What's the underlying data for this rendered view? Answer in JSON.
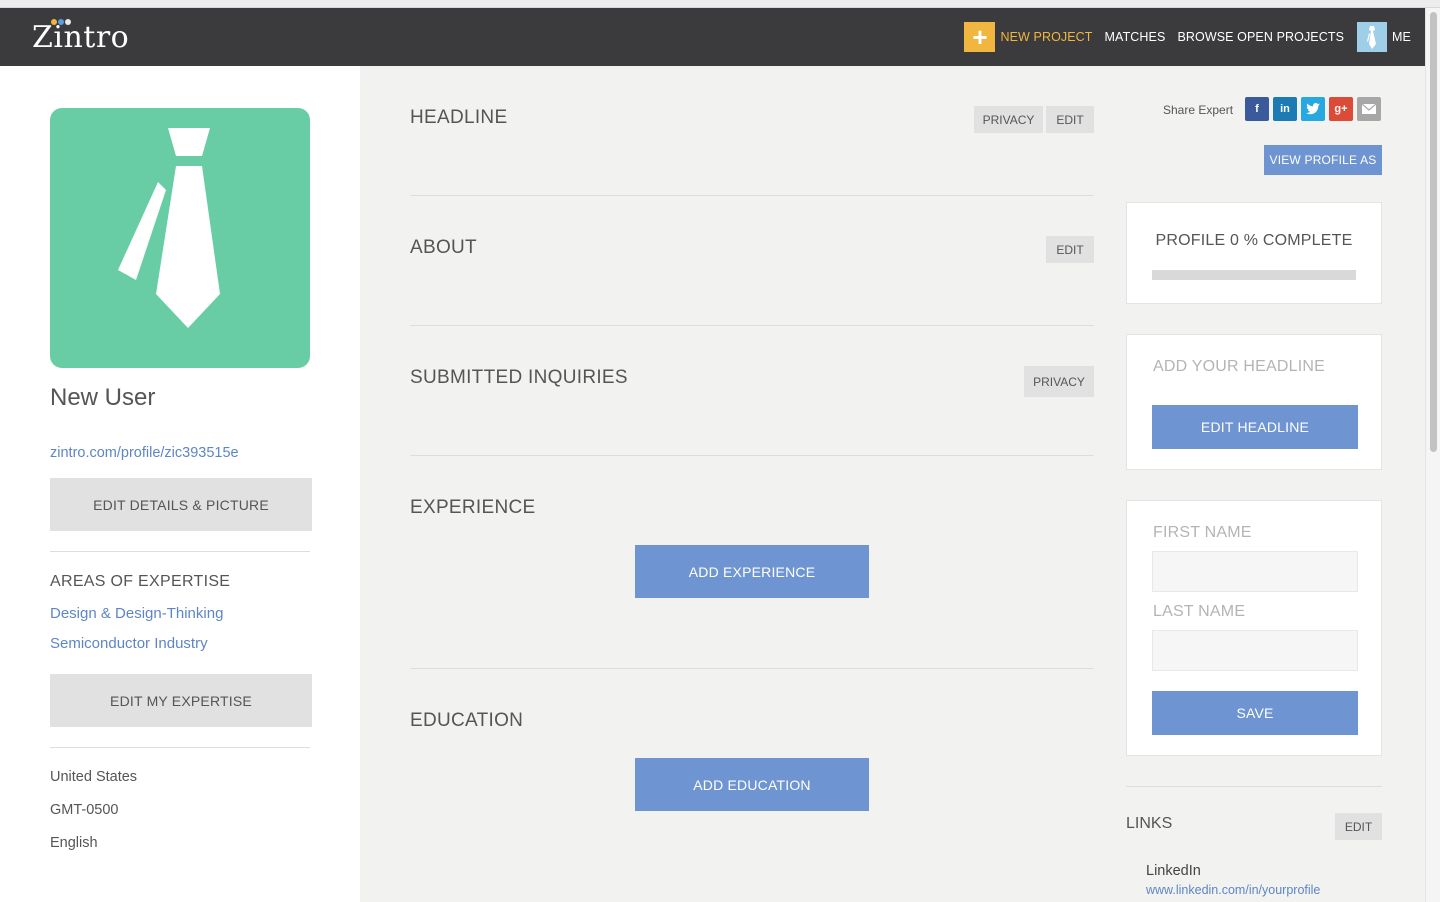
{
  "nav": {
    "logo": "Zintro",
    "new_project": "NEW PROJECT",
    "matches": "MATCHES",
    "browse": "BROWSE OPEN PROJECTS",
    "me": "ME",
    "accent_color": "#f0b63f"
  },
  "sidebar": {
    "user_name": "New User",
    "profile_url": "zintro.com/profile/zic393515e",
    "edit_details_label": "EDIT DETAILS & PICTURE",
    "expertise_title": "AREAS OF EXPERTISE",
    "expertise": [
      "Design & Design-Thinking",
      "Semiconductor Industry"
    ],
    "edit_expertise_label": "EDIT MY EXPERTISE",
    "country": "United States",
    "timezone": "GMT-0500",
    "language": "English",
    "avatar_color": "#68cda4"
  },
  "main": {
    "headline": {
      "title": "HEADLINE",
      "privacy": "PRIVACY",
      "edit": "EDIT"
    },
    "about": {
      "title": "ABOUT",
      "edit": "EDIT"
    },
    "inquiries": {
      "title": "SUBMITTED INQUIRIES",
      "privacy": "PRIVACY"
    },
    "experience": {
      "title": "EXPERIENCE",
      "add": "ADD EXPERIENCE"
    },
    "education": {
      "title": "EDUCATION",
      "add": "ADD EDUCATION"
    }
  },
  "right": {
    "share_label": "Share Expert",
    "share_icons": [
      {
        "name": "facebook-icon",
        "glyph": "f",
        "color": "#3b5a9b"
      },
      {
        "name": "linkedin-icon",
        "glyph": "in",
        "color": "#1c7bb5"
      },
      {
        "name": "twitter-icon",
        "glyph": "t",
        "color": "#27a8e0"
      },
      {
        "name": "google-plus-icon",
        "glyph": "g+",
        "color": "#dc4a38"
      },
      {
        "name": "email-icon",
        "glyph": "✉",
        "color": "#a7a7a7"
      }
    ],
    "view_profile_as": "VIEW PROFILE AS",
    "profile_complete": "PROFILE 0 % COMPLETE",
    "profile_progress": 0,
    "add_headline_title": "ADD YOUR HEADLINE",
    "edit_headline": "EDIT HEADLINE",
    "first_name_label": "FIRST NAME",
    "last_name_label": "LAST NAME",
    "first_name_value": "",
    "last_name_value": "",
    "save": "SAVE",
    "links_title": "LINKS",
    "links_edit": "EDIT",
    "link_name": "LinkedIn",
    "link_url": "www.linkedin.com/in/yourprofile",
    "button_color": "#6e95d1"
  }
}
